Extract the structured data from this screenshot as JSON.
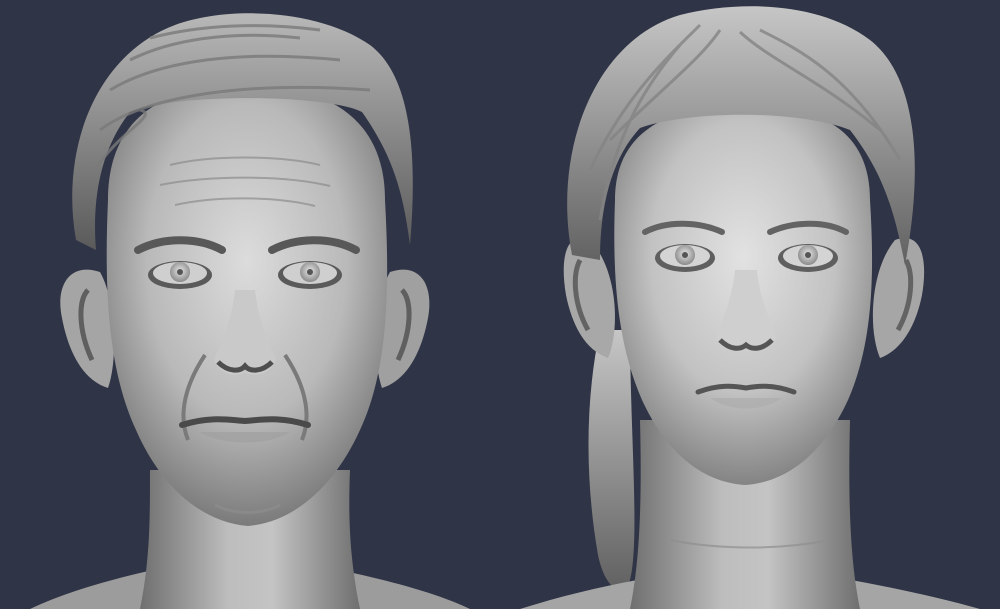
{
  "scene": {
    "subjects": [
      {
        "id": "male",
        "icon": "male-head-sculpt"
      },
      {
        "id": "female",
        "icon": "female-head-sculpt"
      }
    ]
  },
  "colors": {
    "background": "#2f3446",
    "clay_light": "#d9d9d9",
    "clay_mid": "#a9a9a9",
    "clay_dark": "#5e5e5e",
    "shadow": "#2b2b2b"
  }
}
